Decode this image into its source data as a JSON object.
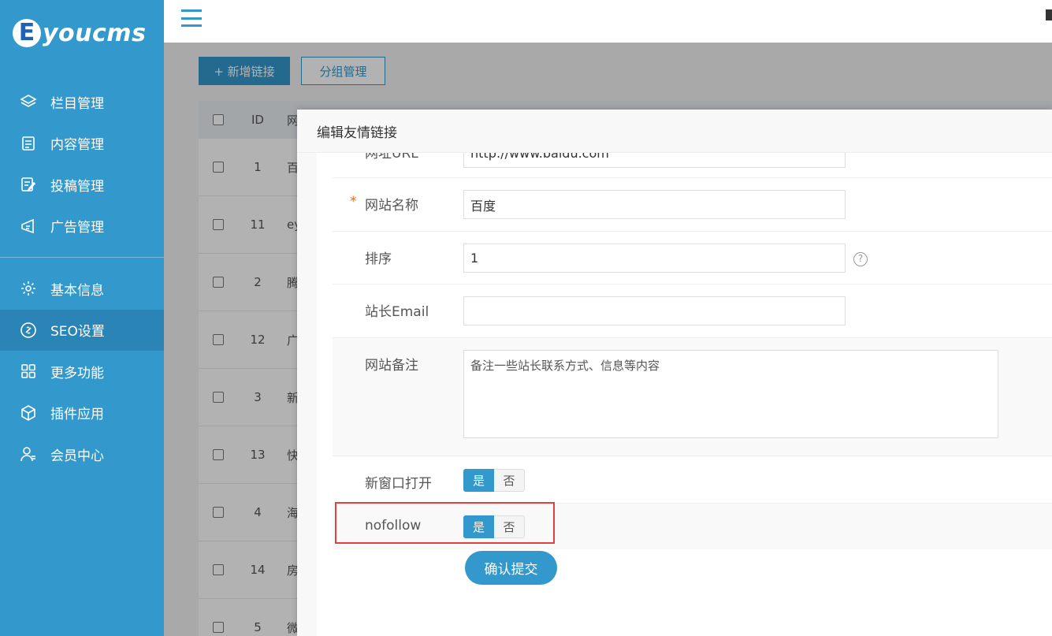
{
  "app": {
    "logo_letter": "E",
    "logo_text": "youcms"
  },
  "sidebar": {
    "items": [
      {
        "label": "栏目管理",
        "icon": "layers-icon"
      },
      {
        "label": "内容管理",
        "icon": "document-icon"
      },
      {
        "label": "投稿管理",
        "icon": "edit-doc-icon"
      },
      {
        "label": "广告管理",
        "icon": "ad-icon"
      },
      {
        "label": "基本信息",
        "icon": "gear-icon"
      },
      {
        "label": "SEO设置",
        "icon": "link-icon",
        "active": true
      },
      {
        "label": "更多功能",
        "icon": "grid-icon"
      },
      {
        "label": "插件应用",
        "icon": "cube-icon"
      },
      {
        "label": "会员中心",
        "icon": "user-icon"
      }
    ]
  },
  "toolbar": {
    "add_label": "+ 新增链接",
    "group_label": "分组管理"
  },
  "table": {
    "headers": {
      "id": "ID",
      "name": "网"
    },
    "rows": [
      {
        "id": "1",
        "name": "百"
      },
      {
        "id": "11",
        "name": "ey"
      },
      {
        "id": "2",
        "name": "腾"
      },
      {
        "id": "12",
        "name": "广"
      },
      {
        "id": "3",
        "name": "新"
      },
      {
        "id": "13",
        "name": "快"
      },
      {
        "id": "4",
        "name": "海"
      },
      {
        "id": "14",
        "name": "房"
      },
      {
        "id": "5",
        "name": "微"
      }
    ]
  },
  "modal": {
    "title": "编辑友情链接",
    "url_label": "网址URL",
    "url_value": "http://www.baidu.com",
    "required_mark": "*",
    "site_name_label": "网站名称",
    "site_name_value": "百度",
    "sort_label": "排序",
    "sort_value": "1",
    "help_glyph": "?",
    "email_label": "站长Email",
    "email_value": "",
    "remark_label": "网站备注",
    "remark_value": "备注一些站长联系方式、信息等内容",
    "new_window_label": "新窗口打开",
    "nofollow_label": "nofollow",
    "yes": "是",
    "no": "否",
    "submit": "确认提交"
  },
  "colors": {
    "primary": "#3398cc",
    "highlight": "#e0403f",
    "required": "#ff6600"
  }
}
